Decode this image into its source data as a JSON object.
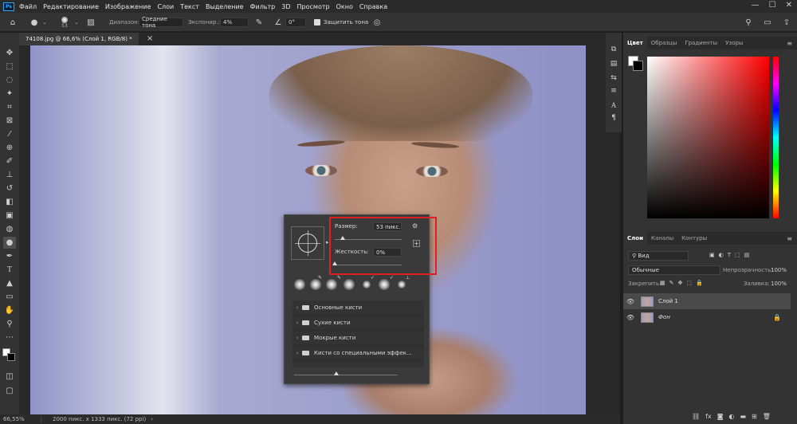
{
  "app": {
    "logo": "Ps"
  },
  "menu": [
    "Файл",
    "Редактирование",
    "Изображение",
    "Слои",
    "Текст",
    "Выделение",
    "Фильтр",
    "3D",
    "Просмотр",
    "Окно",
    "Справка"
  ],
  "window_controls": {
    "minimize": "—",
    "maximize": "☐",
    "close": "✕"
  },
  "options_bar": {
    "brush_size": "53",
    "range_label": "Диапазон:",
    "range_value": "Средние тона",
    "exposure_label": "Экспонир.:",
    "exposure_value": "4%",
    "angle_value": "0°",
    "protect_tones_label": "Защитить тона"
  },
  "document": {
    "tab_title": "74108.jpg @ 66,6% (Слой 1, RGB/8) *",
    "close": "×"
  },
  "brush_popup": {
    "size_label": "Размер:",
    "size_value": "53 пикс.",
    "size_fraction": 0.12,
    "hardness_label": "Жесткость:",
    "hardness_value": "0%",
    "hardness_fraction": 0.0,
    "groups": [
      "Основные кисти",
      "Сухие кисти",
      "Мокрые кисти",
      "Кисти со специальными эффек..."
    ]
  },
  "status_bar": {
    "zoom": "66,55%",
    "info": "2000 пикс. x 1333 пикс. (72 ppi)",
    "arrow": "›"
  },
  "color_panel": {
    "tabs": [
      "Цвет",
      "Образцы",
      "Градиенты",
      "Узоры"
    ],
    "foreground": "#ffffff",
    "background": "#000000"
  },
  "layers_panel": {
    "tabs": [
      "Слои",
      "Каналы",
      "Контуры"
    ],
    "filter_value": "Вид",
    "blend_mode": "Обычные",
    "opacity_label": "Непрозрачность:",
    "opacity_value": "100%",
    "lock_label": "Закрепить:",
    "fill_label": "Заливка:",
    "fill_value": "100%",
    "layers": [
      {
        "name": "Слой 1",
        "selected": true,
        "locked": false
      },
      {
        "name": "Фон",
        "selected": false,
        "locked": true
      }
    ]
  }
}
